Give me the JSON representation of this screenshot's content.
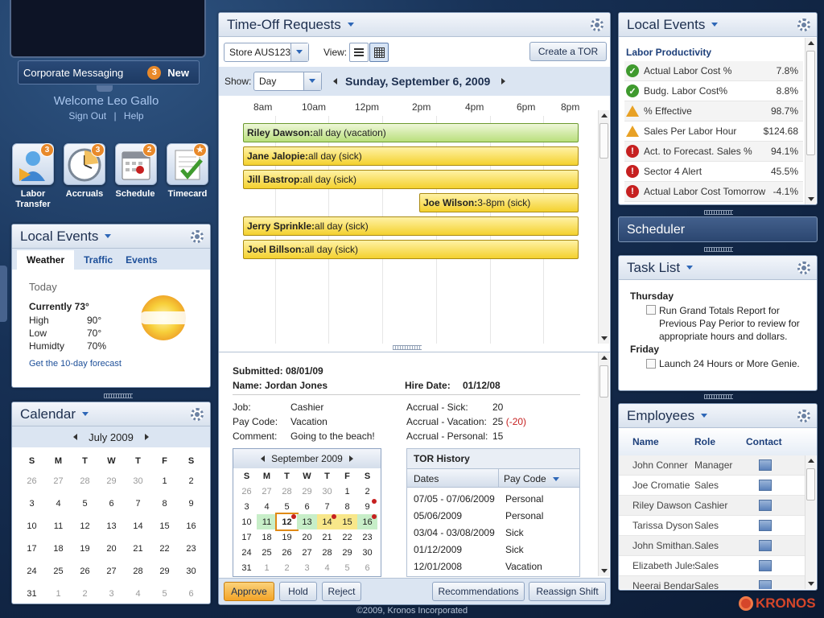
{
  "messaging": {
    "label": "Corporate Messaging",
    "count": "3",
    "new_label": "New"
  },
  "user": {
    "welcome": "Welcome Leo Gallo",
    "sign_out": "Sign Out",
    "sep": "|",
    "help": "Help"
  },
  "apps": [
    {
      "label": "Labor Transfer",
      "label1": "Labor",
      "label2": "Transfer",
      "badge": "3",
      "icon": "labor-transfer-icon"
    },
    {
      "label": "Accruals",
      "badge": "3",
      "icon": "clock-icon"
    },
    {
      "label": "Schedule",
      "badge": "2",
      "icon": "calendar-icon"
    },
    {
      "label": "Timecard",
      "badge": "★",
      "icon": "timecard-check-icon"
    }
  ],
  "weather_panel": {
    "title": "Local Events",
    "tabs": [
      "Weather",
      "Traffic",
      "Events"
    ],
    "day": "Today",
    "current": "Currently 73°",
    "rows": [
      {
        "k": "High",
        "v": "90°"
      },
      {
        "k": "Low",
        "v": "70°"
      },
      {
        "k": "Humidty",
        "v": "70%"
      }
    ],
    "forecast_link": "Get the 10-day forecast"
  },
  "calendar": {
    "title": "Calendar",
    "month": "July 2009",
    "days": [
      "S",
      "M",
      "T",
      "W",
      "T",
      "F",
      "S"
    ],
    "weeks": [
      [
        "26",
        "27",
        "28",
        "29",
        "30",
        "1",
        "2"
      ],
      [
        "3",
        "4",
        "5",
        "6",
        "7",
        "8",
        "9"
      ],
      [
        "10",
        "11",
        "12",
        "13",
        "14",
        "15",
        "16"
      ],
      [
        "17",
        "18",
        "19",
        "20",
        "21",
        "22",
        "23"
      ],
      [
        "24",
        "25",
        "26",
        "27",
        "28",
        "29",
        "30"
      ],
      [
        "31",
        "1",
        "2",
        "3",
        "4",
        "5",
        "6"
      ]
    ]
  },
  "tor": {
    "title": "Time-Off Requests",
    "store": "Store AUS123",
    "view_label": "View:",
    "create_btn": "Create a TOR",
    "show_label": "Show:",
    "show_value": "Day",
    "date": "Sunday, September 6, 2009",
    "hours": [
      "8am",
      "10am",
      "12pm",
      "2pm",
      "4pm",
      "6pm",
      "8pm"
    ],
    "requests": [
      {
        "name": "Riley Dawson:",
        "detail": " all day (vacation)"
      },
      {
        "name": "Jane Jalopie:",
        "detail": " all day (sick)"
      },
      {
        "name": "Jill Bastrop:",
        "detail": " all day (sick)"
      },
      {
        "name": "Joe Wilson:",
        "detail": " 3-8pm (sick)"
      },
      {
        "name": "Jerry Sprinkle:",
        "detail": " all day (sick)"
      },
      {
        "name": "Joel Billson:",
        "detail": " all day (sick)"
      }
    ],
    "detail": {
      "submitted": "Submitted: 08/01/09",
      "name": "Name:  Jordan Jones",
      "hire_label": "Hire Date:",
      "hire_value": "01/12/08",
      "left": [
        {
          "k": "Job:",
          "v": "Cashier"
        },
        {
          "k": "Pay Code:",
          "v": "Vacation"
        },
        {
          "k": "Comment:",
          "v": "Going to the beach!"
        }
      ],
      "accruals": [
        {
          "k": "Accrual - Sick:",
          "v": "20",
          "d": ""
        },
        {
          "k": "Accrual - Vacation:",
          "v": "25",
          "d": "(-20)"
        },
        {
          "k": "Accrual - Personal:",
          "v": "15",
          "d": ""
        }
      ]
    },
    "mini_cal": {
      "month": "September 2009",
      "days": [
        "S",
        "M",
        "T",
        "W",
        "T",
        "F",
        "S"
      ],
      "weeks": [
        [
          "26",
          "27",
          "28",
          "29",
          "30",
          "1",
          "2"
        ],
        [
          "3",
          "4",
          "5",
          "6",
          "7",
          "8",
          "9"
        ],
        [
          "10",
          "11",
          "12",
          "13",
          "14",
          "15",
          "16"
        ],
        [
          "17",
          "18",
          "19",
          "20",
          "21",
          "22",
          "23"
        ],
        [
          "24",
          "25",
          "26",
          "27",
          "28",
          "29",
          "30"
        ],
        [
          "31",
          "1",
          "2",
          "3",
          "4",
          "5",
          "6"
        ]
      ]
    },
    "history": {
      "title": "TOR History",
      "col1": "Dates",
      "col2": "Pay Code",
      "rows": [
        {
          "d": "07/05 - 07/06/2009",
          "c": "Personal"
        },
        {
          "d": "05/06/2009",
          "c": "Personal"
        },
        {
          "d": "03/04 - 03/08/2009",
          "c": "Sick"
        },
        {
          "d": "01/12/2009",
          "c": "Sick"
        },
        {
          "d": "12/01/2008",
          "c": "Vacation"
        }
      ]
    },
    "buttons": {
      "approve": "Approve",
      "hold": "Hold",
      "reject": "Reject",
      "recommend": "Recommendations",
      "reassign": "Reassign Shift"
    }
  },
  "labor": {
    "title": "Local Events",
    "section": "Labor Productivity",
    "rows": [
      {
        "k": "Actual Labor Cost %",
        "v": "7.8%",
        "s": "ok"
      },
      {
        "k": "Budg. Labor Cost%",
        "v": "8.8%",
        "s": "ok"
      },
      {
        "k": "% Effective",
        "v": "98.7%",
        "s": "warn"
      },
      {
        "k": "Sales Per Labor Hour",
        "v": "$124.68",
        "s": "warn"
      },
      {
        "k": "Act. to Forecast. Sales %",
        "v": "94.1%",
        "s": "alert"
      },
      {
        "k": "Sector 4 Alert",
        "v": "45.5%",
        "s": "alert"
      },
      {
        "k": "Actual Labor Cost Tomorrow",
        "v": "-4.1%",
        "s": "alert"
      }
    ]
  },
  "scheduler": {
    "title": "Scheduler"
  },
  "tasks": {
    "title": "Task List",
    "day1": "Thursday",
    "task1": "Run Grand Totals Report for Previous Pay Perior to review for appropriate hours and dollars.",
    "day2": "Friday",
    "task2": "Launch 24 Hours or More Genie."
  },
  "employees": {
    "title": "Employees",
    "cols": [
      "Name",
      "Role",
      "Contact"
    ],
    "rows": [
      {
        "n": "John Conner",
        "r": "Manager"
      },
      {
        "n": "Joe Cromatie",
        "r": "Sales"
      },
      {
        "n": "Riley Dawson",
        "r": "Cashier"
      },
      {
        "n": "Tarissa Dyson",
        "r": "Sales"
      },
      {
        "n": "John Smithan...",
        "r": "Sales"
      },
      {
        "n": "Elizabeth Jules",
        "r": "Sales"
      },
      {
        "n": "Neerai Bendan",
        "r": "Sales"
      }
    ]
  },
  "footer": {
    "copyright": "©2009, Kronos Incorporated",
    "brand": "KRONOS"
  },
  "colors": {
    "accent": "#2e67b7",
    "ok": "#3f9a2e",
    "warn": "#e8a125",
    "alert": "#c62020",
    "approve": "#f3a428"
  }
}
